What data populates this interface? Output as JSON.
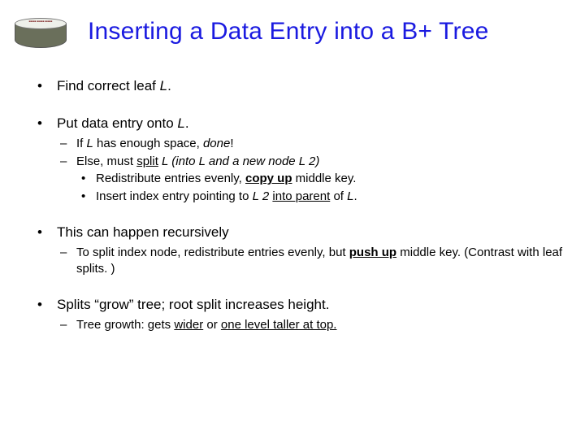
{
  "title": "Inserting a Data Entry into a B+ Tree",
  "bullets": {
    "b1": {
      "t1": "Find correct leaf ",
      "t2": "L",
      "t3": "."
    },
    "b2": {
      "t1": "Put data entry onto ",
      "t2": "L",
      "t3": ".",
      "s1": {
        "a": "If ",
        "b": "L",
        "c": " has enough space, ",
        "d": "done",
        "e": "!"
      },
      "s2": {
        "a": "Else, must ",
        "b": "split",
        "c": "  ",
        "d": "L (into L and a new node L 2)",
        "r1": {
          "a": "Redistribute entries evenly, ",
          "b": "copy up",
          "c": " middle key."
        },
        "r2": {
          "a": "Insert index entry pointing to ",
          "b": "L 2",
          "c": " ",
          "d": "into parent",
          "e": " of ",
          "f": "L",
          "g": "."
        }
      }
    },
    "b3": {
      "t1": "This can happen recursively",
      "s1": {
        "a": "To split index node, redistribute entries evenly, but ",
        "b": "push up",
        "c": " middle key. (Contrast with leaf splits. )"
      }
    },
    "b4": {
      "t1": "Splits “grow” tree; root split increases height.",
      "s1": {
        "a": "Tree growth: gets ",
        "b": "wider",
        "c": " or ",
        "d": "one level taller at top.",
        "e": ""
      }
    }
  }
}
